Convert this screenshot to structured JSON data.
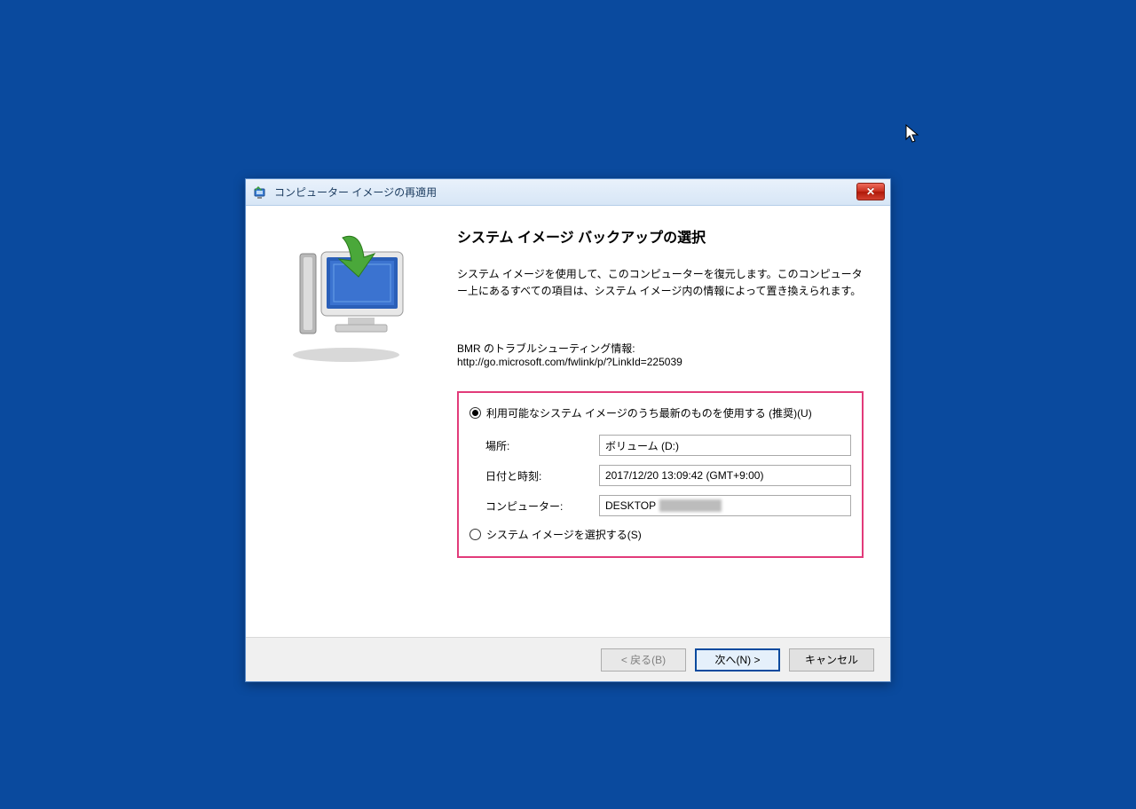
{
  "window": {
    "title": "コンピューター イメージの再適用"
  },
  "content": {
    "heading": "システム イメージ バックアップの選択",
    "description": "システム イメージを使用して、このコンピューターを復元します。このコンピューター上にあるすべての項目は、システム イメージ内の情報によって置き換えられます。",
    "troubleshoot_label": "BMR のトラブルシューティング情報:",
    "troubleshoot_link": "http://go.microsoft.com/fwlink/p/?LinkId=225039"
  },
  "options": {
    "use_latest_label": "利用可能なシステム イメージのうち最新のものを使用する (推奨)(U)",
    "select_image_label": "システム イメージを選択する(S)"
  },
  "fields": {
    "location_label": "場所:",
    "location_value": "ボリューム (D:)",
    "datetime_label": "日付と時刻:",
    "datetime_value": "2017/12/20 13:09:42 (GMT+9:00)",
    "computer_label": "コンピューター:",
    "computer_value": "DESKTOP"
  },
  "buttons": {
    "back": "< 戻る(B)",
    "next": "次へ(N) >",
    "cancel": "キャンセル",
    "close": "✕"
  }
}
